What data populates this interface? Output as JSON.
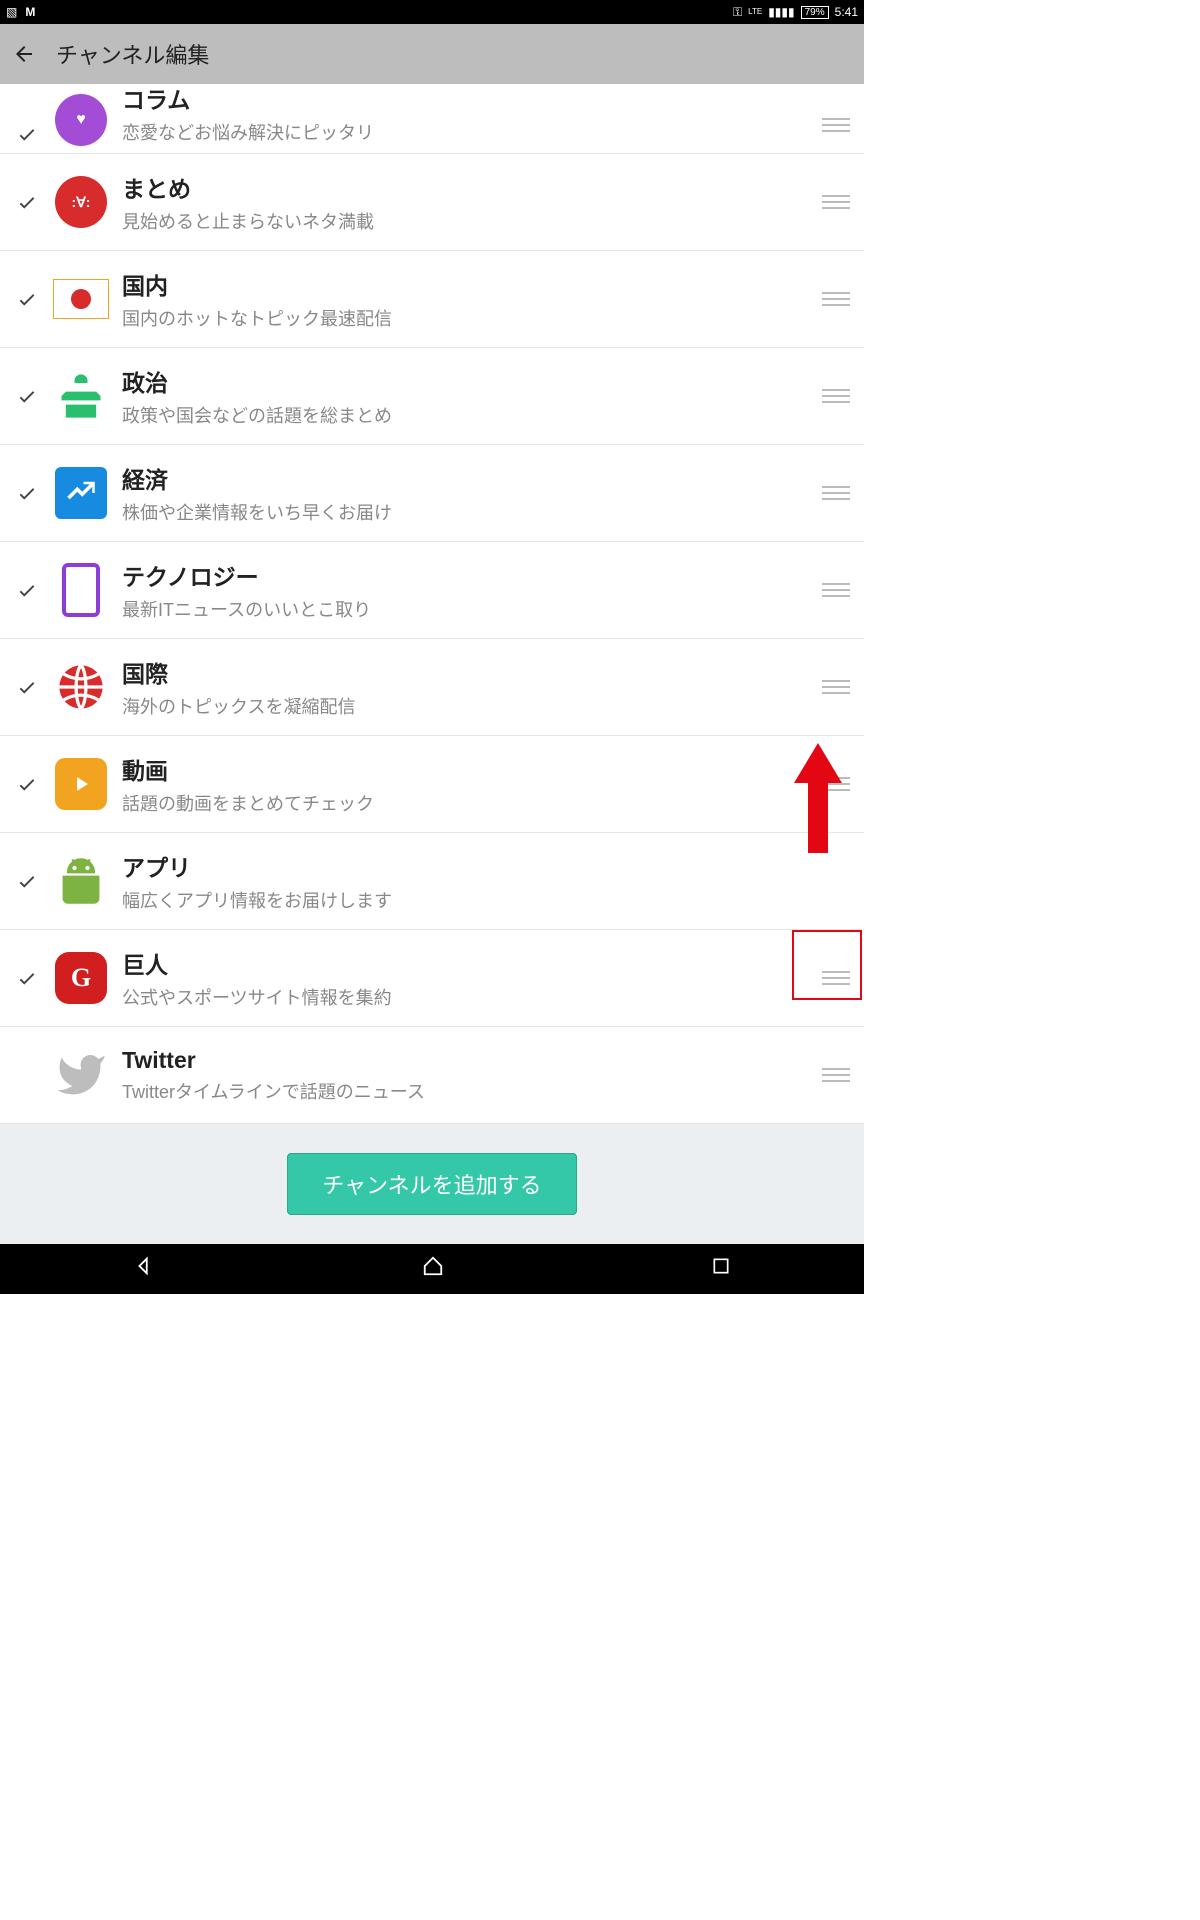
{
  "status": {
    "network": "LTE",
    "battery": "79%",
    "time": "5:41"
  },
  "header": {
    "title": "チャンネル編集"
  },
  "channels": [
    {
      "title": "コラム",
      "subtitle": "恋愛などお悩み解決にピッタリ",
      "checked": true,
      "icon": "heart",
      "color": "purple"
    },
    {
      "title": "まとめ",
      "subtitle": "見始めると止まらないネタ満載",
      "checked": true,
      "icon": "face",
      "color": "red"
    },
    {
      "title": "国内",
      "subtitle": "国内のホットなトピック最速配信",
      "checked": true,
      "icon": "japan-flag",
      "color": "white"
    },
    {
      "title": "政治",
      "subtitle": "政策や国会などの話題を総まとめ",
      "checked": true,
      "icon": "podium",
      "color": "green"
    },
    {
      "title": "経済",
      "subtitle": "株価や企業情報をいち早くお届け",
      "checked": true,
      "icon": "chart",
      "color": "blue"
    },
    {
      "title": "テクノロジー",
      "subtitle": "最新ITニュースのいいとこ取り",
      "checked": true,
      "icon": "phone",
      "color": "rpurple"
    },
    {
      "title": "国際",
      "subtitle": "海外のトピックスを凝縮配信",
      "checked": true,
      "icon": "globe",
      "color": "globe"
    },
    {
      "title": "動画",
      "subtitle": "話題の動画をまとめてチェック",
      "checked": true,
      "icon": "play",
      "color": "orange"
    },
    {
      "title": "アプリ",
      "subtitle": "幅広くアプリ情報をお届けします",
      "checked": true,
      "icon": "android",
      "color": "android"
    },
    {
      "title": "巨人",
      "subtitle": "公式やスポーツサイト情報を集約",
      "checked": true,
      "icon": "giants",
      "color": "giants",
      "highlighted": true
    },
    {
      "title": "Twitter",
      "subtitle": "Twitterタイムラインで話題のニュース",
      "checked": false,
      "icon": "twitter",
      "color": "tw"
    }
  ],
  "footer": {
    "add_label": "チャンネルを追加する"
  },
  "annotation": {
    "arrow_direction": "up",
    "highlight_target": "巨人 drag handle"
  }
}
